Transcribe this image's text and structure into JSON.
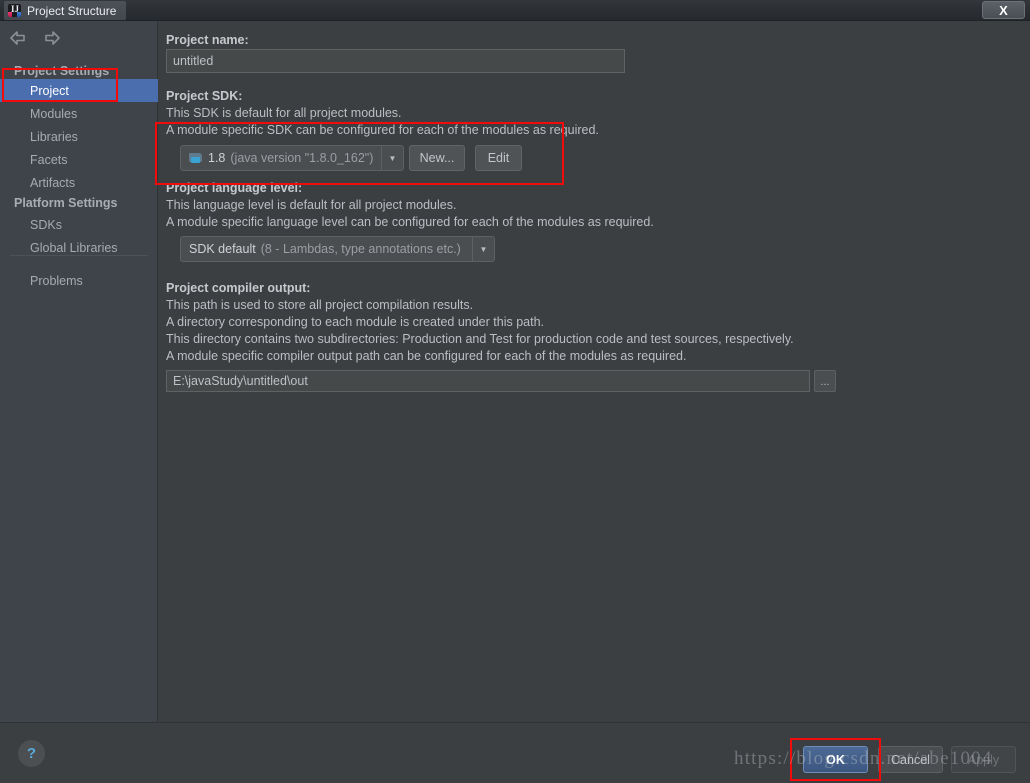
{
  "window": {
    "title": "Project Structure",
    "app_icon": "intellij-idea-icon",
    "close_label": "X"
  },
  "sidebar": {
    "nav": {
      "back": "back-arrow",
      "forward": "forward-arrow"
    },
    "groups": [
      {
        "header": "Project Settings",
        "items": [
          {
            "label": "Project",
            "selected": true
          },
          {
            "label": "Modules",
            "selected": false
          },
          {
            "label": "Libraries",
            "selected": false
          },
          {
            "label": "Facets",
            "selected": false
          },
          {
            "label": "Artifacts",
            "selected": false
          }
        ]
      },
      {
        "header": "Platform Settings",
        "items": [
          {
            "label": "SDKs",
            "selected": false
          },
          {
            "label": "Global Libraries",
            "selected": false
          }
        ]
      }
    ],
    "extra_items": [
      {
        "label": "Problems",
        "selected": false
      }
    ]
  },
  "main": {
    "project_name": {
      "label": "Project name:",
      "value": "untitled"
    },
    "project_sdk": {
      "label": "Project SDK:",
      "desc1": "This SDK is default for all project modules.",
      "desc2": "A module specific SDK can be configured for each of the modules as required.",
      "selected_name": "1.8",
      "selected_detail": "(java version \"1.8.0_162\")",
      "icon": "sdk-folder-icon",
      "dropdown_arrow": "chevron-down-icon",
      "new_button": "New...",
      "edit_button": "Edit"
    },
    "language_level": {
      "label": "Project language level:",
      "desc1": "This language level is default for all project modules.",
      "desc2": "A module specific language level can be configured for each of the modules as required.",
      "selected_name": "SDK default",
      "selected_detail": "(8 - Lambdas, type annotations etc.)",
      "dropdown_arrow": "chevron-down-icon"
    },
    "compiler_output": {
      "label": "Project compiler output:",
      "desc1": "This path is used to store all project compilation results.",
      "desc2": "A directory corresponding to each module is created under this path.",
      "desc3": "This directory contains two subdirectories: Production and Test for production code and test sources, respectively.",
      "desc4": "A module specific compiler output path can be configured for each of the modules as required.",
      "value": "E:\\javaStudy\\untitled\\out",
      "browse_label": "..."
    }
  },
  "footer": {
    "help_label": "?",
    "ok_label": "OK",
    "cancel_label": "Cancel",
    "apply_label": "Apply"
  },
  "annotations": {
    "watermark": "https://blog.csdn.net/abe1004",
    "highlight_color": "#f10b0b"
  }
}
